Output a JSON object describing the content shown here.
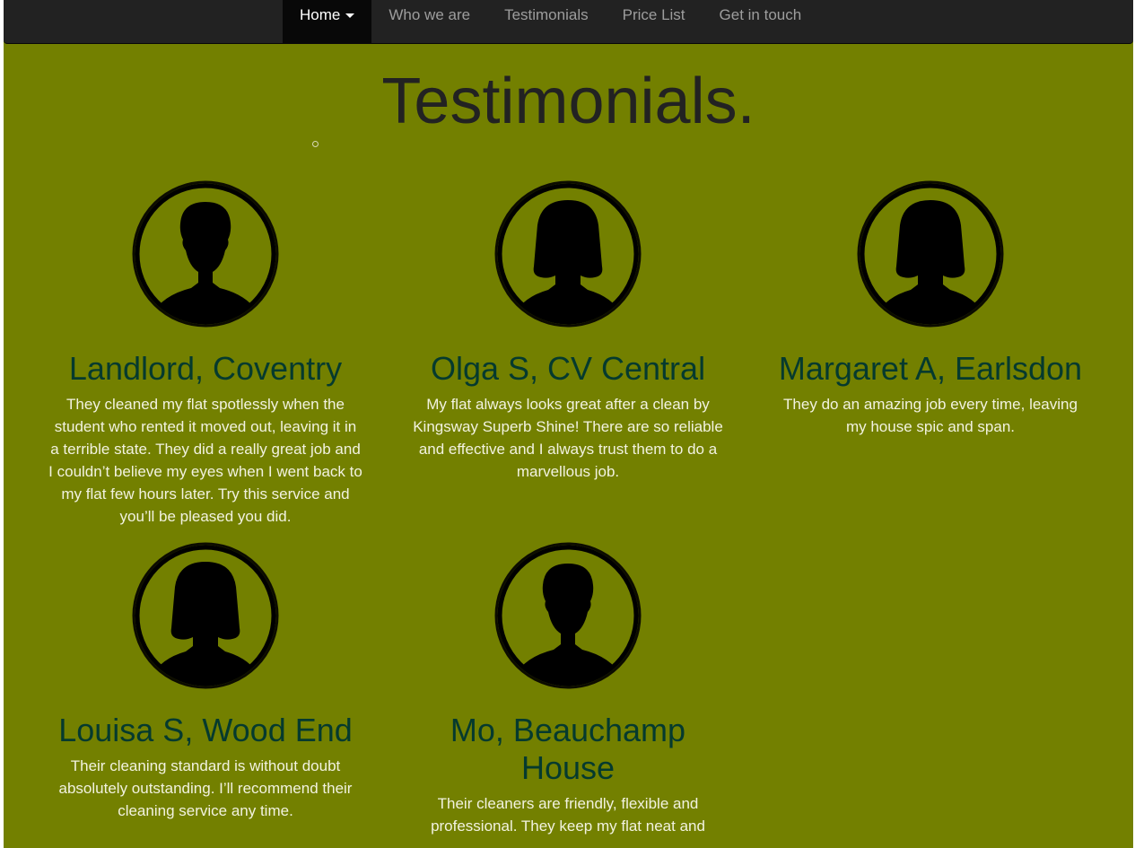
{
  "nav": {
    "items": [
      {
        "label": "Home",
        "active": true,
        "has_dropdown": true
      },
      {
        "label": "Who we are"
      },
      {
        "label": "Testimonials"
      },
      {
        "label": "Price List"
      },
      {
        "label": "Get in touch"
      }
    ]
  },
  "page_title": "Testimonials.",
  "testimonials": [
    {
      "name": "Landlord, Coventry",
      "avatar": "male-silhouette-icon",
      "text": "They cleaned my flat spotlessly when the student who rented it moved out, leaving it in a terrible state. They did a really great job and I couldn’t believe my eyes when I went back to my flat few hours later. Try this service and you’ll be pleased you did."
    },
    {
      "name": "Olga S, CV Central",
      "avatar": "female-silhouette-icon",
      "text": "My flat always looks great after a clean by Kingsway Superb Shine! There are so reliable and effective and I always trust them to do a marvellous job."
    },
    {
      "name": "Margaret A, Earlsdon",
      "avatar": "female-silhouette-icon",
      "text": "They do an amazing job every time, leaving my house spic and span."
    },
    {
      "name": "Louisa S, Wood End",
      "avatar": "female-silhouette-icon",
      "text": "Their cleaning standard is without doubt absolutely outstanding. I’ll recommend their cleaning service any time."
    },
    {
      "name": "Mo, Beauchamp House",
      "avatar": "male-silhouette-icon",
      "text": "Their cleaners are friendly, flexible and professional. They keep my flat neat and"
    }
  ],
  "colors": {
    "page_background": "#738000",
    "navbar_background": "#222222",
    "name_color": "#053a2e",
    "text_color": "#f2f2e0",
    "title_color": "#222222"
  }
}
